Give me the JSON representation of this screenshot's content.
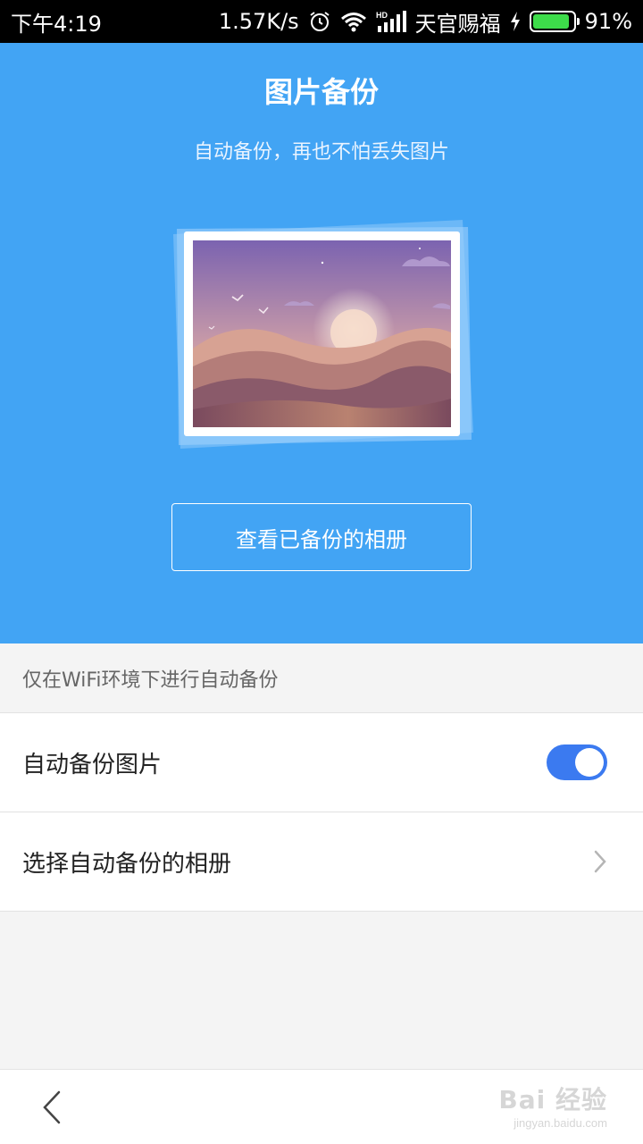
{
  "status_bar": {
    "time": "下午4:19",
    "speed": "1.57K/s",
    "carrier": "天官赐福",
    "battery_percent": "91%",
    "battery_level": 0.91,
    "icons": [
      "alarm-icon",
      "wifi-icon",
      "hd-signal-icon",
      "charging-icon",
      "battery-icon"
    ],
    "signal_badge": "HD"
  },
  "hero": {
    "title": "图片备份",
    "subtitle": "自动备份，再也不怕丢失图片",
    "view_button_label": "查看已备份的相册",
    "background_color": "#42a4f4"
  },
  "settings": {
    "wifi_note": "仅在WiFi环境下进行自动备份",
    "auto_backup_label": "自动备份图片",
    "auto_backup_enabled": true,
    "select_album_label": "选择自动备份的相册",
    "toggle_color": "#3b7af0"
  },
  "bottom_bar": {
    "back_icon": "chevron-left-icon",
    "watermark_logo": "Bai 经验",
    "watermark_url": "jingyan.baidu.com"
  }
}
